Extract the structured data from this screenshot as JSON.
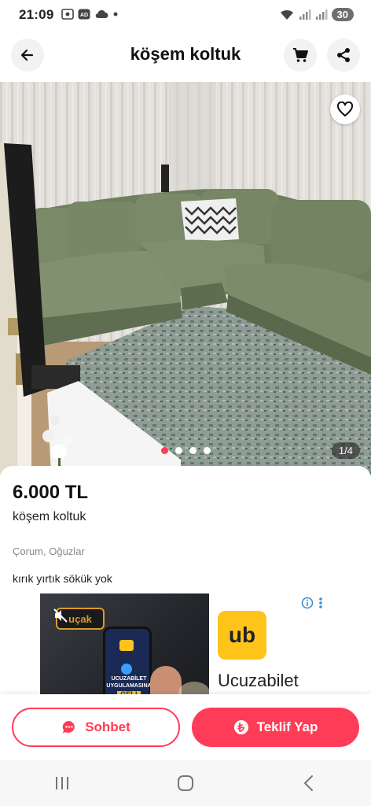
{
  "status_bar": {
    "time": "21:09",
    "battery": "30"
  },
  "header": {
    "title": "köşem koltuk"
  },
  "gallery": {
    "counter": "1/4",
    "total_images": 4,
    "current_index": 0
  },
  "listing": {
    "price": "6.000 TL",
    "title": "köşem koltuk",
    "location": "Çorum, Oğuzlar",
    "description": "kırık yırtık sökük yok"
  },
  "ad": {
    "brand": "Ucuzabilet",
    "logo_text": "ub",
    "banner_lines": [
      "UCUZABİLET",
      "UYGULAMASINA",
      "GEL!"
    ],
    "tag_text": "uçak"
  },
  "actions": {
    "chat_label": "Sohbet",
    "offer_label": "Teklif Yap"
  },
  "colors": {
    "accent": "#ff3c57",
    "ad_logo": "#ffc41a"
  },
  "icons": {
    "back": "arrow-left-icon",
    "cart": "cart-icon",
    "share": "share-icon",
    "favorite": "heart-icon",
    "chat": "chat-bubble-icon",
    "offer": "coin-icon",
    "info": "info-icon",
    "more": "more-vertical-icon"
  }
}
